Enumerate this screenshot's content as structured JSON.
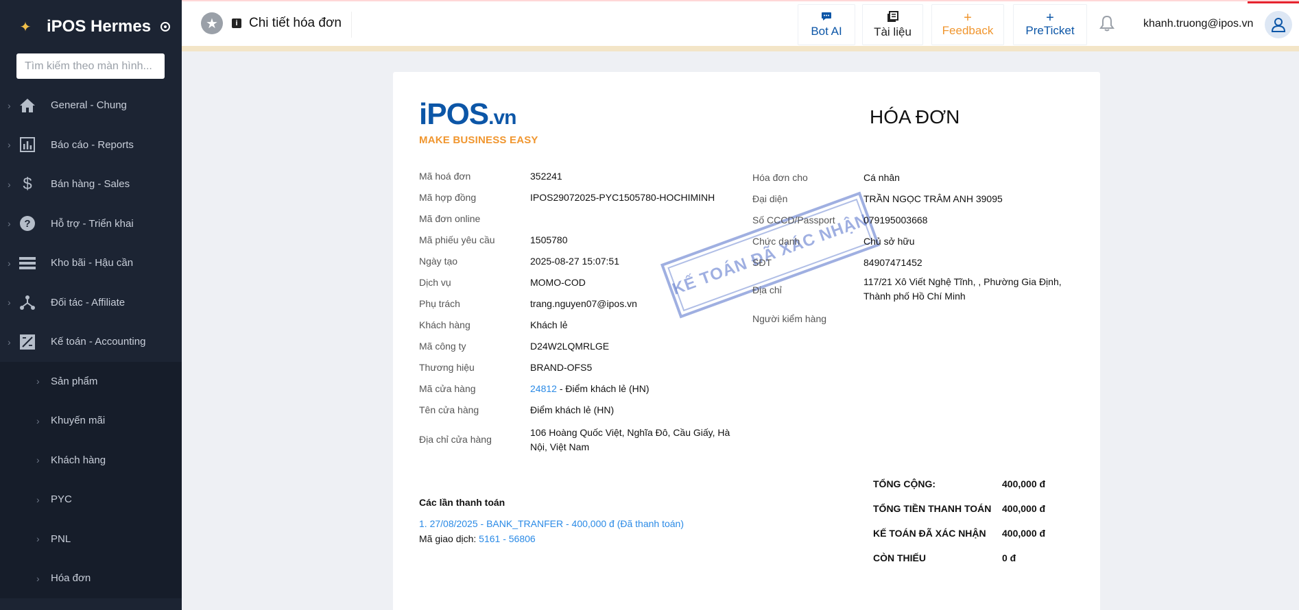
{
  "app": {
    "name": "iPOS Hermes"
  },
  "search": {
    "placeholder": "Tìm kiếm theo màn hình..."
  },
  "sidebar": {
    "items": [
      {
        "label": "General - Chung"
      },
      {
        "label": "Báo cáo - Reports"
      },
      {
        "label": "Bán hàng - Sales"
      },
      {
        "label": "Hỗ trợ - Triển khai"
      },
      {
        "label": "Kho bãi - Hậu cần"
      },
      {
        "label": "Đối tác - Affiliate"
      },
      {
        "label": "Kế toán - Accounting"
      }
    ],
    "subitems": [
      {
        "label": "Sản phẩm"
      },
      {
        "label": "Khuyến mãi"
      },
      {
        "label": "Khách hàng"
      },
      {
        "label": "PYC"
      },
      {
        "label": "PNL"
      },
      {
        "label": "Hóa đơn"
      }
    ]
  },
  "header": {
    "title": "Chi tiết hóa đơn",
    "buttons": {
      "bot": "Bot AI",
      "docs": "Tài liệu",
      "feedback": "Feedback",
      "preticket": "PreTicket"
    },
    "user_email": "khanh.truong@ipos.vn"
  },
  "invoice": {
    "logo_main": "iPOS",
    "logo_suffix": ".vn",
    "logo_tagline": "MAKE BUSINESS EASY",
    "title": "HÓA ĐƠN",
    "left": {
      "ma_hoa_don": {
        "label": "Mã hoá đơn",
        "value": "352241"
      },
      "ma_hop_dong": {
        "label": "Mã hợp đồng",
        "value": "IPOS29072025-PYC1505780-HOCHIMINH"
      },
      "ma_don_online": {
        "label": "Mã đơn online",
        "value": ""
      },
      "ma_phieu": {
        "label": "Mã phiếu yêu cầu",
        "value": "1505780"
      },
      "ngay_tao": {
        "label": "Ngày tạo",
        "value": "2025-08-27 15:07:51"
      },
      "dich_vu": {
        "label": "Dịch vụ",
        "value": "MOMO-COD"
      },
      "phu_trach": {
        "label": "Phụ trách",
        "value": "trang.nguyen07@ipos.vn"
      },
      "khach_hang": {
        "label": "Khách hàng",
        "value": "Khách lẻ"
      },
      "ma_cong_ty": {
        "label": "Mã công ty",
        "value": "D24W2LQMRLGE"
      },
      "thuong_hieu": {
        "label": "Thương hiệu",
        "value": "BRAND-OFS5"
      },
      "ma_cua_hang": {
        "label": "Mã cửa hàng",
        "value": "24812",
        "suffix": " - Điểm khách lẻ (HN)"
      },
      "ten_cua_hang": {
        "label": "Tên cửa hàng",
        "value": "Điểm khách lẻ (HN)"
      },
      "dia_chi_cua_hang": {
        "label": "Địa chỉ cửa hàng",
        "line1": "106 Hoàng Quốc Việt, Nghĩa Đô, Cầu Giấy, Hà",
        "line2": "Nội, Việt Nam"
      }
    },
    "right": {
      "hoa_don_cho": {
        "label": "Hóa đơn cho",
        "value": "Cá nhân"
      },
      "dai_dien": {
        "label": "Đại diện",
        "value": "TRẦN NGỌC TRÂM ANH 39095"
      },
      "cccd": {
        "label": "Số CCCD/Passport",
        "value": "079195003668"
      },
      "chuc_danh": {
        "label": "Chức danh",
        "value": "Chủ sở hữu"
      },
      "sdt": {
        "label": "SĐT",
        "value": "84907471452"
      },
      "dia_chi": {
        "label": "Địa chỉ",
        "line1": "117/21 Xô Viết Nghệ Tĩnh, , Phường Gia Định,",
        "line2": "Thành phố Hồ Chí Minh"
      },
      "nguoi_kiem_hang": {
        "label": "Người kiểm hàng",
        "value": ""
      }
    },
    "stamp": "KẾ TOÁN ĐÃ XÁC NHẬN",
    "payments": {
      "title": "Các lần thanh toán",
      "line": "1. 27/08/2025 - BANK_TRANFER - 400,000 đ (Đã thanh toán)",
      "code_label": "Mã giao dịch: ",
      "code_value": "5161 - 56806"
    },
    "totals": [
      {
        "label": "TỔNG CỘNG:",
        "value": "400,000 đ"
      },
      {
        "label": "TỔNG TIỀN THANH TOÁN",
        "value": "400,000 đ"
      },
      {
        "label": "KẾ TOÁN ĐÃ XÁC NHẬN",
        "value": "400,000 đ"
      },
      {
        "label": "CÒN THIẾU",
        "value": "0 đ"
      }
    ]
  },
  "colors": {
    "sidebar_bg": "#1c2433",
    "brand_blue": "#0c56a7",
    "accent_orange": "#f0962f",
    "link_blue": "#2a8ae6"
  }
}
